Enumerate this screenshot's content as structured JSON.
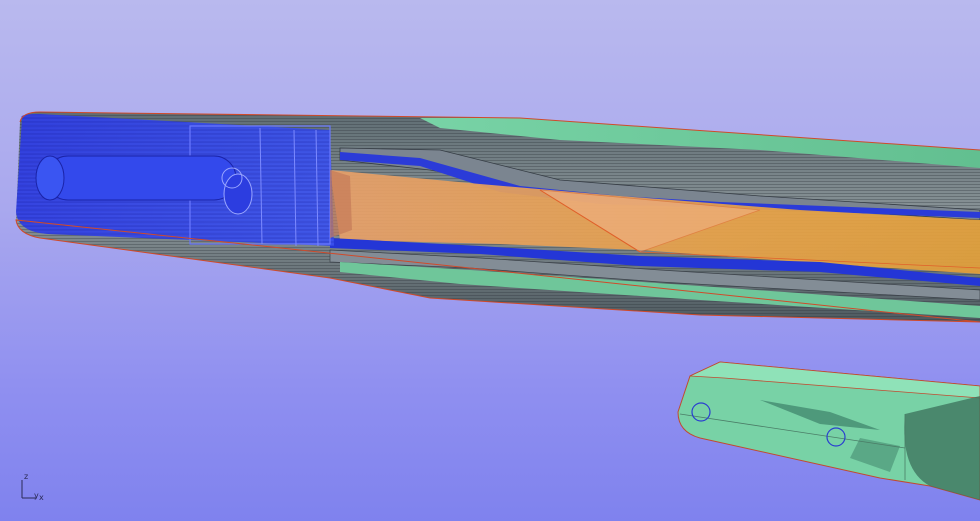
{
  "viewport": {
    "background_top": "#b9b9ee",
    "background_bottom": "#7f82ee"
  },
  "model": {
    "main_part": {
      "shell_color": "#6fc69a",
      "liner_color": "#f0a24a",
      "insert_color": "#2f3fe8",
      "edge_color": "#e04a2a"
    },
    "secondary_part": {
      "shell_color": "#76d0a4",
      "hole_color": "#2a3fd0"
    }
  },
  "axis_triad": {
    "z_label": "z",
    "y_label": "y",
    "x_label": "x"
  }
}
